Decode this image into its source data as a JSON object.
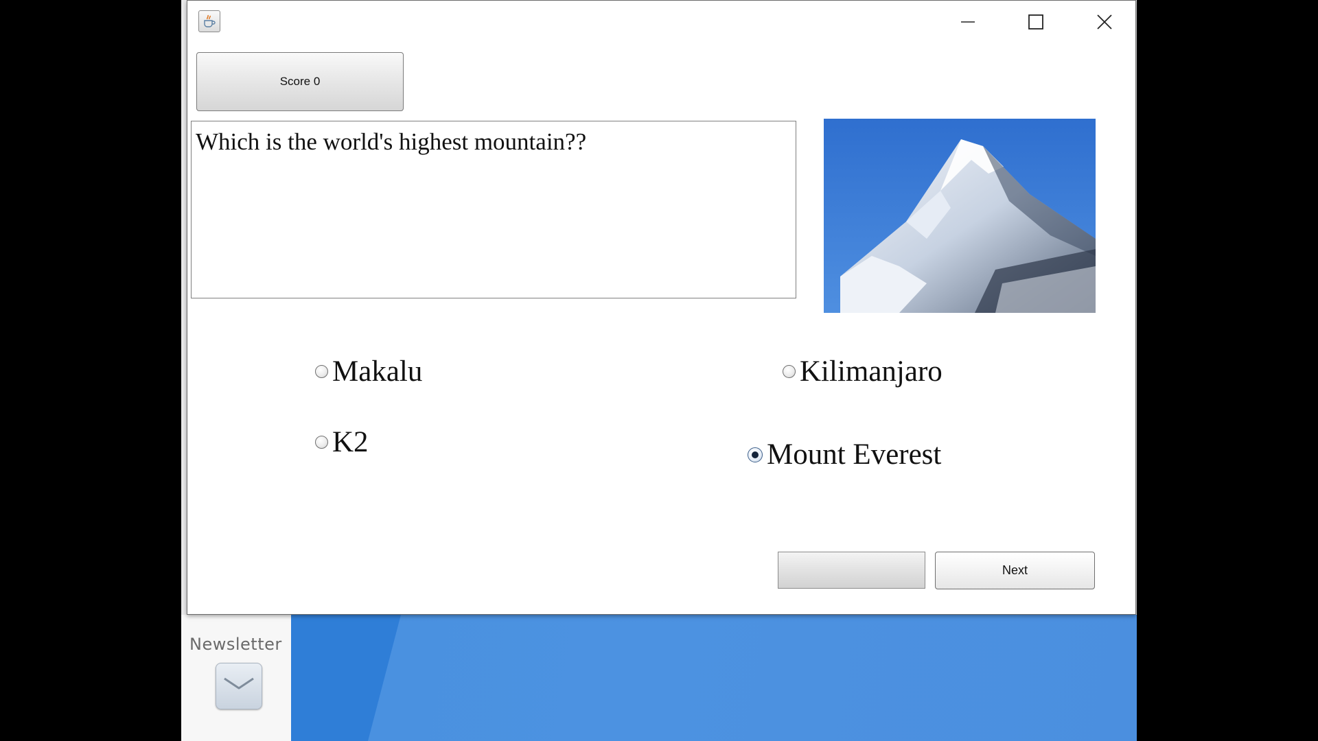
{
  "desktop": {
    "newsletter_label": "Newsletter",
    "newsletter_icon": "mail-envelope-icon"
  },
  "window": {
    "app_icon": "java-coffee-cup-icon",
    "controls": {
      "minimize_icon": "minimize-icon",
      "maximize_icon": "maximize-icon",
      "close_icon": "close-icon"
    }
  },
  "quiz": {
    "score_label": "Score 0",
    "question": "Which is the world's highest mountain??",
    "image_subject": "snow-covered mountain peak",
    "options": [
      {
        "label": "Makalu",
        "selected": false
      },
      {
        "label": "Kilimanjaro",
        "selected": false
      },
      {
        "label": "K2",
        "selected": false
      },
      {
        "label": "Mount Everest",
        "selected": true
      }
    ],
    "blank_button_label": "",
    "next_label": "Next"
  },
  "colors": {
    "desktop_blue": "#4b8fdf",
    "window_bg": "#ffffff",
    "radio_selected": "#15243a"
  }
}
